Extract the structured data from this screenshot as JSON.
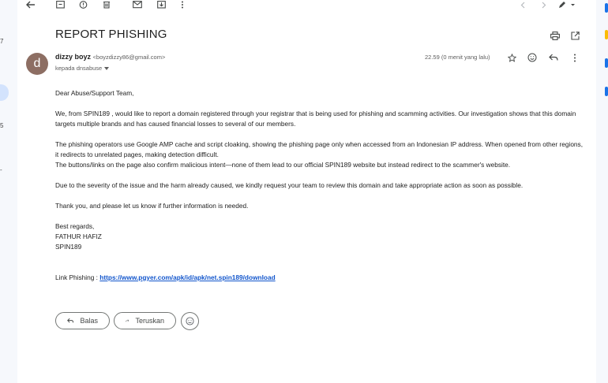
{
  "left_nav": {
    "marks": [
      "7",
      "5",
      "-"
    ]
  },
  "toolbar": {
    "icons": [
      "back-icon",
      "archive-icon",
      "report-spam-icon",
      "delete-icon",
      "mark-unread-icon",
      "move-to-icon",
      "more-vert-icon",
      "prev-icon",
      "next-icon",
      "pen-icon"
    ]
  },
  "email": {
    "subject": "REPORT PHISHING",
    "avatar_letter": "d",
    "avatar_color": "#8d6e63",
    "sender_name": "dizzy boyz",
    "sender_email": "<boyzdizzy86@gmail.com>",
    "to_line": "kepada dnsabuse",
    "time": "22.59 (0 menit yang lalu)",
    "body": {
      "greeting": "Dear Abuse/Support Team,",
      "p1": "We, from SPIN189 , would like to report a domain registered through your registrar that is being used for phishing and scamming activities. Our investigation shows that this domain targets multiple brands and has caused financial losses to several of our members.",
      "p2a": "The phishing operators use Google AMP cache and script cloaking, showing the phishing page only when accessed from an Indonesian IP address. When opened from other regions, it redirects to unrelated pages, making detection difficult.",
      "p2b": "The buttons/links on the page also confirm malicious intent—none of them lead to our official SPIN189  website but instead redirect to the scammer's website.",
      "p3": "Due to the severity of the issue and the harm already caused, we kindly request your team to review this domain and take appropriate action as soon as possible.",
      "p4": "Thank you, and please let us know if further information is needed.",
      "closing": "Best regards,",
      "sig_name": "FATHUR HAFIZ",
      "sig_org": "SPIN189",
      "link_label": "Link Phishing : ",
      "link_url": "https://www.pgyer.com/apk/id/apk/net.spin189/download"
    }
  },
  "actions": {
    "reply_label": "Balas",
    "forward_label": "Teruskan"
  },
  "colors": {
    "link": "#1155cc",
    "sidebar_highlight": "#d3e3fd",
    "background": "#f6f8fc"
  }
}
